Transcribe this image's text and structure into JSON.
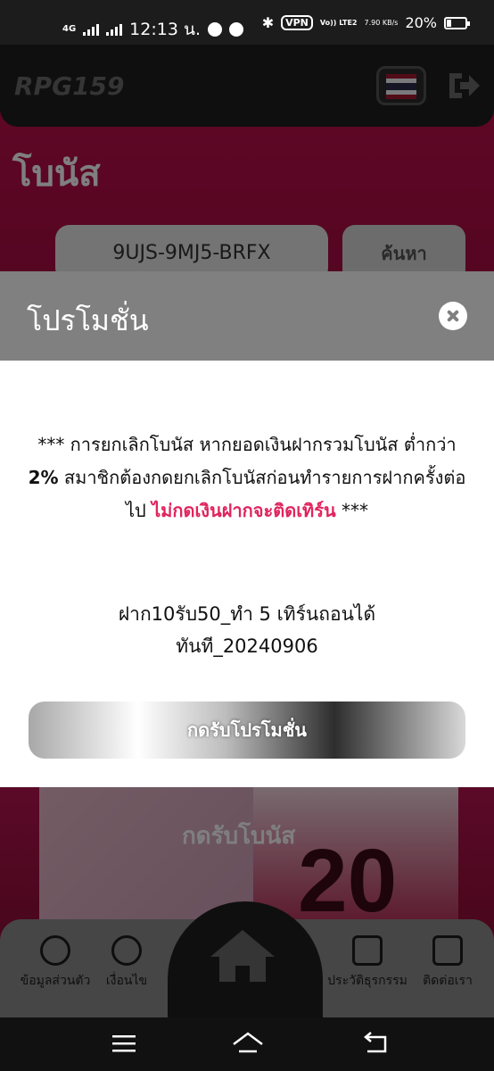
{
  "status_bar": {
    "network": "4G",
    "time": "12:13 น.",
    "vpn": "VPN",
    "volte": "Vo)) LTE2",
    "speed": "7.90 KB/s",
    "battery": "20%"
  },
  "app": {
    "logo": "RPG159",
    "page_title": "โบนัส",
    "code_value": "9UJS-9MJ5-BRFX",
    "search_label": "ค้นหา",
    "banner_text": "กดรับโบนัส",
    "banner_big": "20",
    "nav": {
      "profile": "ข้อมูลส่วนตัว",
      "terms": "เงื่อนไข",
      "history": "ประวัติธุรกรรม",
      "contact": "ติดต่อเรา"
    }
  },
  "modal": {
    "title": "โปรโมชั่น",
    "notice_part1": "*** การยกเลิกโบนัส หากยอดเงินฝากรวมโบนัส ต่ำกว่า ",
    "notice_bold": "2%",
    "notice_part2": " สมาชิกต้องกดยกเลิกโบนัสก่อนทำรายการฝากครั้งต่อไป ",
    "notice_red": "ไม่กดเงินฝากจะติดเทิร์น",
    "notice_end": " ***",
    "promo_name_line1": "ฝาก10รับ50_ทำ 5 เทิร์นถอนได้",
    "promo_name_line2": "ทันที_20240906",
    "claim_label": "กดรับโปรโมชั่น"
  }
}
